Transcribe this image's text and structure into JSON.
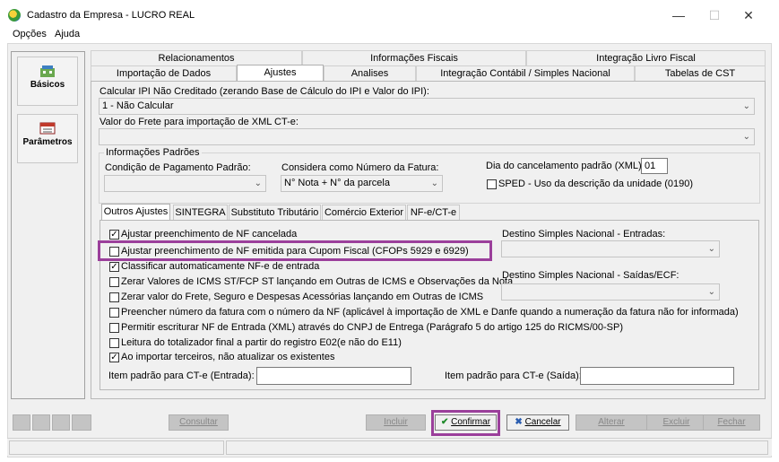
{
  "window": {
    "title": "Cadastro da Empresa - LUCRO REAL",
    "minimize": "—",
    "maximize": "☐",
    "close": "✕"
  },
  "menu": [
    "Opções",
    "Ajuda"
  ],
  "sidebar": {
    "items": [
      {
        "label": "Básicos",
        "icon": "building-icon"
      },
      {
        "label": "Parâmetros",
        "icon": "calendar-icon"
      }
    ]
  },
  "tabs": {
    "row1": [
      "Relacionamentos",
      "Informações Fiscais",
      "Integração Livro Fiscal"
    ],
    "row2": [
      "Importação de Dados",
      "Ajustes",
      "Analises",
      "Integração Contábil / Simples Nacional",
      "Tabelas de CST"
    ],
    "active": "Ajustes"
  },
  "ipi": {
    "label": "Calcular IPI Não Creditado (zerando Base de Cálculo do IPI e Valor do IPI):",
    "value": "1 - Não Calcular"
  },
  "frete": {
    "label": "Valor do Frete para importação de XML CT-e:",
    "value": ""
  },
  "padroes": {
    "legend": "Informações Padrões",
    "condicao_label": "Condição de Pagamento Padrão:",
    "condicao_value": "",
    "fatura_label": "Considera como Número da Fatura:",
    "fatura_value": "N° Nota + N° da parcela",
    "dia_label": "Dia do cancelamento padrão (XML):",
    "dia_value": "01",
    "sped_label": "SPED - Uso da descrição da unidade (0190)",
    "sped_checked": false
  },
  "subtabs": [
    "Outros Ajustes",
    "SINTEGRA",
    "Substituto Tributário",
    "Comércio Exterior",
    "NF-e/CT-e"
  ],
  "outros": {
    "checks": [
      {
        "label": "Ajustar preenchimento de NF cancelada",
        "checked": true
      },
      {
        "label": "Ajustar preenchimento de NF emitida para Cupom Fiscal (CFOPs 5929 e 6929)",
        "checked": false
      },
      {
        "label": "Classificar automaticamente NF-e de entrada",
        "checked": true
      },
      {
        "label": "Zerar Valores de ICMS ST/FCP ST lançando em Outras de ICMS e Observações da Nota",
        "checked": false
      },
      {
        "label": "Zerar valor do Frete, Seguro e Despesas Acessórias lançando em Outras de ICMS",
        "checked": false
      },
      {
        "label": "Preencher número da fatura com o número da NF (aplicável à importação de XML e Danfe quando a numeração da fatura não for informada)",
        "checked": false
      },
      {
        "label": "Permitir escriturar NF de Entrada (XML) através do CNPJ de Entrega (Parágrafo 5 do artigo 125 do RICMS/00-SP)",
        "checked": false
      },
      {
        "label": "Leitura do totalizador final a partir do registro E02(e não do E11)",
        "checked": false
      },
      {
        "label": "Ao importar terceiros, não atualizar os existentes",
        "checked": true
      }
    ],
    "destino_entradas_label": "Destino Simples Nacional - Entradas:",
    "destino_entradas_value": "",
    "destino_saidas_label": "Destino Simples Nacional - Saídas/ECF:",
    "destino_saidas_value": "",
    "item_entrada_label": "Item padrão para CT-e (Entrada):",
    "item_entrada_value": "",
    "item_saida_label": "Item padrão para CT-e (Saída):",
    "item_saida_value": ""
  },
  "buttons": {
    "consultar": "Consultar",
    "incluir": "Incluir",
    "confirmar": "Confirmar",
    "cancelar": "Cancelar",
    "alterar": "Alterar",
    "excluir": "Excluir",
    "fechar": "Fechar"
  },
  "colors": {
    "highlight": "#9b3f9b",
    "confirm_icon": "#1f8a2a",
    "cancel_icon": "#2a5db0"
  }
}
